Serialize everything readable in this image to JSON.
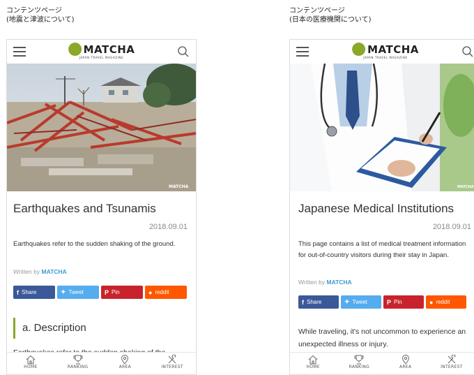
{
  "captions": {
    "left": [
      "コンテンツページ",
      "(地震と津波について)"
    ],
    "right": [
      "コンテンツページ",
      "(日本の医療機関について)"
    ]
  },
  "brand": {
    "name": "MATCHA",
    "tagline": "JAPAN TRAVEL MAGAZINE",
    "accent": "#8aa82a",
    "link_color": "#3a9ccf"
  },
  "watermark": "MATCHA",
  "left_page": {
    "title": "Earthquakes and Tsunamis",
    "date": "2018.09.01",
    "lead": "Earthquakes refer to the sudden shaking of the ground.",
    "written_prefix": "Written by",
    "author": "MATCHA",
    "section_heading": "a. Description",
    "body_cut": "Earthquakes refer to the sudden shaking of the"
  },
  "right_page": {
    "title": "Japanese Medical Institutions",
    "date": "2018.09.01",
    "lead": "This page contains a list of medical treatment information for out-of-country visitors during their stay in Japan.",
    "written_prefix": "Written by",
    "author": "MATCHA",
    "body": "While traveling, it's not uncommon to experience an unexpected illness or injury."
  },
  "share_buttons": [
    {
      "icon": "f",
      "label": "Share",
      "color": "#3b5998"
    },
    {
      "icon": "🐦",
      "label": "Tweet",
      "color": "#55acee"
    },
    {
      "icon": "P",
      "label": "Pin",
      "color": "#c8232c"
    },
    {
      "icon": "●",
      "label": "reddit",
      "color": "#ff5700"
    }
  ],
  "tabs": [
    {
      "label": "HOME",
      "icon": "home-icon"
    },
    {
      "label": "RANKING",
      "icon": "trophy-icon"
    },
    {
      "label": "AREA",
      "icon": "map-pin-icon"
    },
    {
      "label": "INTEREST",
      "icon": "tools-icon"
    }
  ]
}
